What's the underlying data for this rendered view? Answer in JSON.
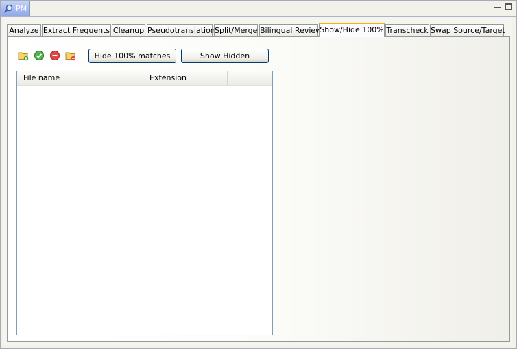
{
  "view": {
    "title": "PM"
  },
  "tabs": [
    {
      "label": "Analyze"
    },
    {
      "label": "Extract Frequents"
    },
    {
      "label": "Cleanup"
    },
    {
      "label": "Pseudotranslation"
    },
    {
      "label": "Split/Merge"
    },
    {
      "label": "Bilingual Review"
    },
    {
      "label": "Show/Hide 100%"
    },
    {
      "label": "Transcheck"
    },
    {
      "label": "Swap Source/Target"
    }
  ],
  "active_tab": "Show/Hide 100%",
  "toolbar": {
    "icons": [
      "add-folder-icon",
      "check-icon",
      "remove-icon",
      "remove-folder-icon"
    ],
    "hide_button": "Hide 100% matches",
    "show_button": "Show Hidden"
  },
  "table": {
    "columns": [
      {
        "label": "File name"
      },
      {
        "label": "Extension"
      }
    ],
    "rows": []
  }
}
